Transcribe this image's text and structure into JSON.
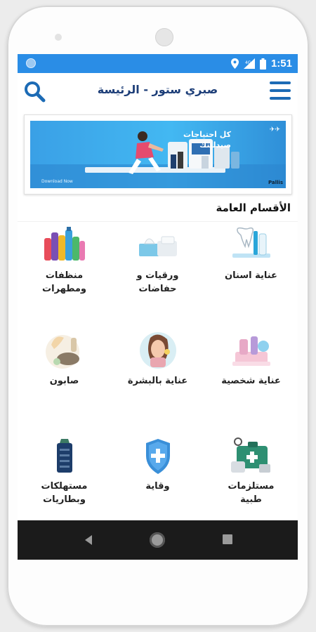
{
  "status_bar": {
    "time": "1:51",
    "icons": [
      "location-icon",
      "signal-icon",
      "battery-icon"
    ],
    "color": "#2a8de6"
  },
  "app_bar": {
    "title": "صبري ستور - الرئيسة",
    "search_icon": "search-icon",
    "menu_icon": "hamburger-menu-icon",
    "accent": "#1c6bb5"
  },
  "banner": {
    "headline": "كل احتياجات\nصيدليتك",
    "download_text": "Download Now",
    "corner_text": "Pallis"
  },
  "section": {
    "title": "الأقسام العامة"
  },
  "categories": [
    {
      "label": "عناية اسنان",
      "icon": "toothbrush-icon"
    },
    {
      "label": "ورقيات و\nحفاضات",
      "icon": "tissues-icon"
    },
    {
      "label": "منظفات\nومطهرات",
      "icon": "cleaning-bottles-icon"
    },
    {
      "label": "عناية شخصية",
      "icon": "personal-care-icon"
    },
    {
      "label": "عناية بالبشرة",
      "icon": "skincare-face-icon"
    },
    {
      "label": "صابون",
      "icon": "soap-icon"
    },
    {
      "label": "مستلزمات\nطبية",
      "icon": "medical-kit-icon"
    },
    {
      "label": "وقاية",
      "icon": "shield-plus-icon"
    },
    {
      "label": "مستهلكات\nوبطاريات",
      "icon": "battery-consumables-icon"
    }
  ],
  "nav_bar": {
    "icons": [
      "back-icon",
      "home-icon",
      "recent-apps-icon"
    ]
  }
}
